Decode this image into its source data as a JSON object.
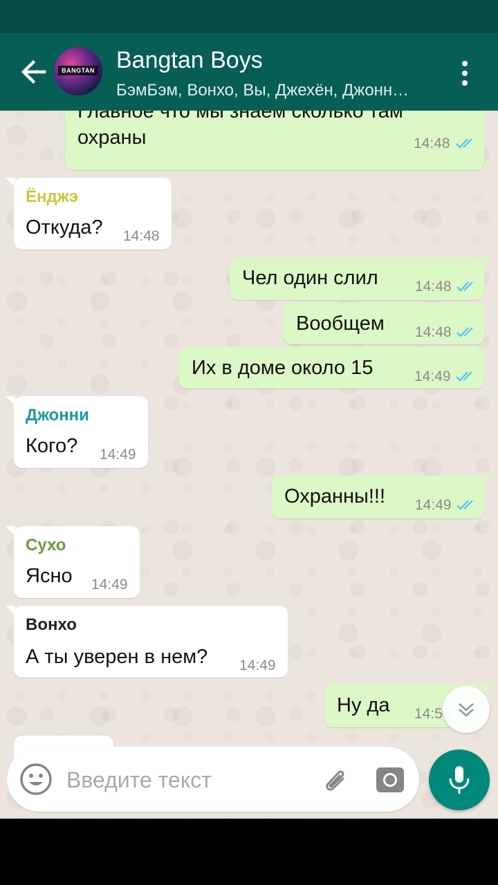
{
  "header": {
    "title": "Bangtan Boys",
    "subtitle": "БэмБэм, Вонхо, Вы, Джехён, Джонн…",
    "avatar_text": "BANGTAN"
  },
  "messages": [
    {
      "type": "out",
      "text_lines": [
        "Главное что мы знаем сколько там",
        "охраны"
      ],
      "time": "14:48",
      "status": "read"
    },
    {
      "type": "in",
      "sender": "Ёнджэ",
      "sender_color": "#c8c83a",
      "text": "Откуда?",
      "time": "14:48"
    },
    {
      "type": "out",
      "text": "Чел один слил",
      "time": "14:48",
      "status": "read"
    },
    {
      "type": "out",
      "text": "Вообщем",
      "time": "14:48",
      "status": "read"
    },
    {
      "type": "out",
      "text": "Их в доме около 15",
      "time": "14:49",
      "status": "read"
    },
    {
      "type": "in",
      "sender": "Джонни",
      "sender_color": "#1e9a98",
      "text": "Кого?",
      "time": "14:49"
    },
    {
      "type": "out",
      "text": "Охранны!!!",
      "time": "14:49",
      "status": "read"
    },
    {
      "type": "in",
      "sender": "Сухо",
      "sender_color": "#6c9a35",
      "text": "Ясно",
      "time": "14:49"
    },
    {
      "type": "in",
      "sender": "Вонхо",
      "sender_color": "#222222",
      "text": "А ты уверен в нем?",
      "time": "14:49"
    },
    {
      "type": "out",
      "text": "Ну да",
      "time": "14:50"
    }
  ],
  "composer": {
    "placeholder": "Введите текст"
  },
  "colors": {
    "toolbar": "#075e54",
    "statusbar": "#054d44",
    "outgoing_bubble": "#dcf8c6",
    "incoming_bubble": "#ffffff",
    "read_ticks": "#4fc3f7",
    "mic_button": "#00897b"
  },
  "icons": [
    "back-arrow-icon",
    "more-vert-icon",
    "double-check-icon",
    "scroll-down-icon",
    "emoji-icon",
    "attach-icon",
    "camera-icon",
    "mic-icon"
  ]
}
